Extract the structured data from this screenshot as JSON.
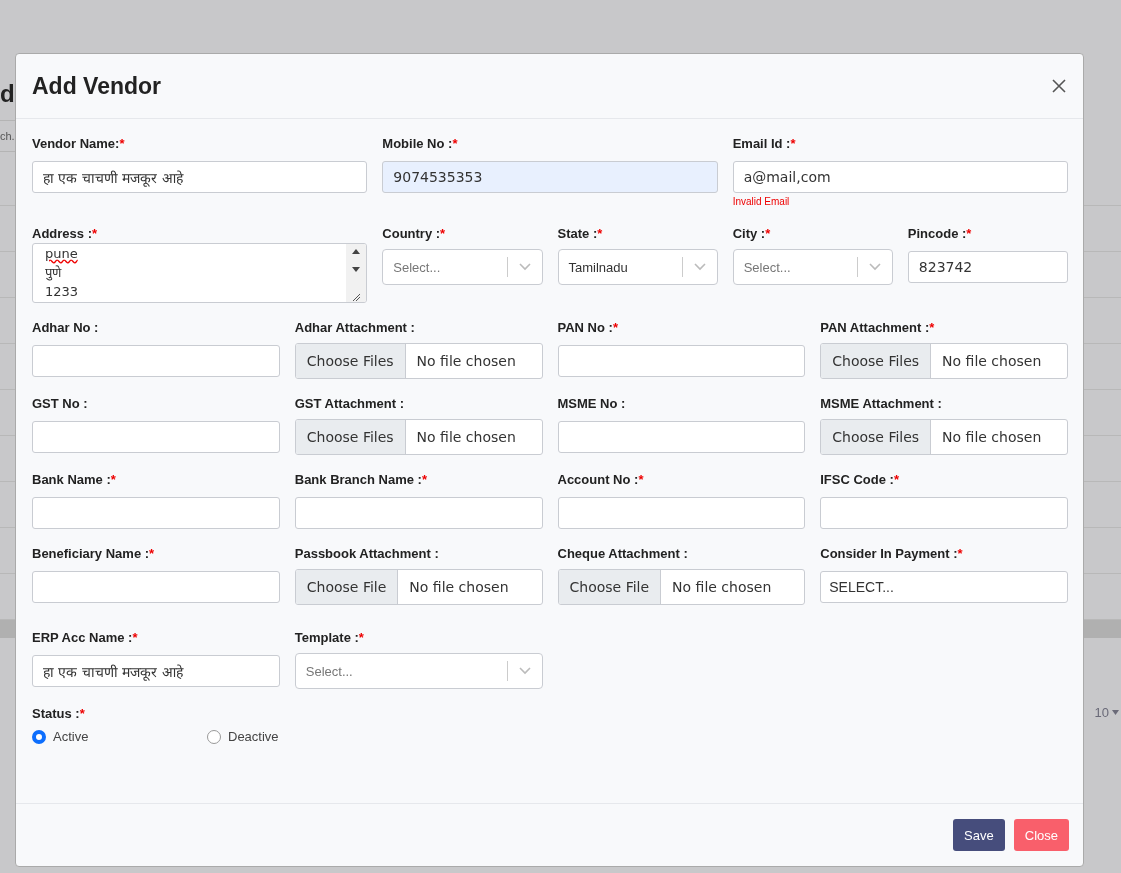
{
  "background": {
    "heading": "d",
    "search_placeholder": "ch.",
    "page_size": "10"
  },
  "dialog": {
    "title": "Add Vendor",
    "rows": [
      {
        "fields": [
          {
            "kind": "text",
            "label": "Vendor Name:",
            "required_mark": "*",
            "value": "हा एक चाचणी मजकूर आहे",
            "highlighted": false
          },
          {
            "kind": "text",
            "label": "Mobile No :",
            "required_mark": "*",
            "value": "9074535353",
            "highlighted": true
          },
          {
            "kind": "text",
            "label": "Email Id :",
            "required_mark": "*",
            "value": "a@mail,com",
            "highlighted": false,
            "error": "Invalid Email"
          }
        ]
      },
      {
        "fields": [
          {
            "kind": "textarea",
            "label": "Address :",
            "required_mark": "*",
            "lines": [
              "pune",
              "पुणे",
              "1233"
            ]
          },
          {
            "kind": "select",
            "label": "Country :",
            "required_mark": "*",
            "placeholder": "Select..."
          },
          {
            "kind": "select",
            "label": "State :",
            "required_mark": "*",
            "value": "Tamilnadu"
          },
          {
            "kind": "select",
            "label": "City :",
            "required_mark": "*",
            "placeholder": "Select..."
          },
          {
            "kind": "text",
            "label": "Pincode :",
            "required_mark": "*",
            "value": "823742",
            "highlighted": false
          }
        ]
      },
      {
        "fields": [
          {
            "kind": "text",
            "label": "Adhar No :",
            "highlighted": false
          },
          {
            "kind": "file",
            "label": "Adhar Attachment :",
            "button": "Choose Files",
            "status": "No file chosen"
          },
          {
            "kind": "text",
            "label": "PAN No :",
            "required_mark": "*",
            "highlighted": false
          },
          {
            "kind": "file",
            "label": "PAN Attachment :",
            "required_mark": "*",
            "button": "Choose Files",
            "status": "No file chosen"
          }
        ]
      },
      {
        "fields": [
          {
            "kind": "text",
            "label": "GST No :",
            "highlighted": false
          },
          {
            "kind": "file",
            "label": "GST Attachment :",
            "button": "Choose Files",
            "status": "No file chosen"
          },
          {
            "kind": "text",
            "label": "MSME No :",
            "highlighted": false
          },
          {
            "kind": "file",
            "label": "MSME Attachment :",
            "button": "Choose Files",
            "status": "No file chosen"
          }
        ]
      },
      {
        "fields": [
          {
            "kind": "text",
            "label": "Bank Name :",
            "required_mark": "*",
            "highlighted": false
          },
          {
            "kind": "text",
            "label": "Bank Branch Name :",
            "required_mark": "*",
            "highlighted": false
          },
          {
            "kind": "text",
            "label": "Account No :",
            "required_mark": "*",
            "highlighted": false
          },
          {
            "kind": "text",
            "label": "IFSC Code :",
            "required_mark": "*",
            "highlighted": false
          }
        ]
      },
      {
        "fields": [
          {
            "kind": "text",
            "label": "Beneficiary Name :",
            "required_mark": "*",
            "highlighted": false
          },
          {
            "kind": "file",
            "label": "Passbook Attachment :",
            "button": "Choose File",
            "status": "No file chosen"
          },
          {
            "kind": "file",
            "label": "Cheque Attachment :",
            "button": "Choose File",
            "status": "No file chosen"
          },
          {
            "kind": "plainselect",
            "label": "Consider In Payment :",
            "required_mark": "*",
            "value": "SELECT..."
          }
        ]
      },
      {
        "fields": [
          {
            "kind": "text",
            "label": "ERP Acc Name :",
            "required_mark": "*",
            "value": "हा एक चाचणी मजकूर आहे",
            "highlighted": false
          },
          {
            "kind": "select",
            "label": "Template :",
            "required_mark": "*",
            "placeholder": "Select..."
          }
        ]
      }
    ],
    "status": {
      "label": "Status :",
      "required_mark": "*",
      "options": [
        {
          "label": "Active",
          "selected": true
        },
        {
          "label": "Deactive",
          "selected": false
        }
      ]
    },
    "buttons": [
      {
        "kind": "primary",
        "label": "Save"
      },
      {
        "kind": "danger",
        "label": "Close"
      }
    ]
  }
}
